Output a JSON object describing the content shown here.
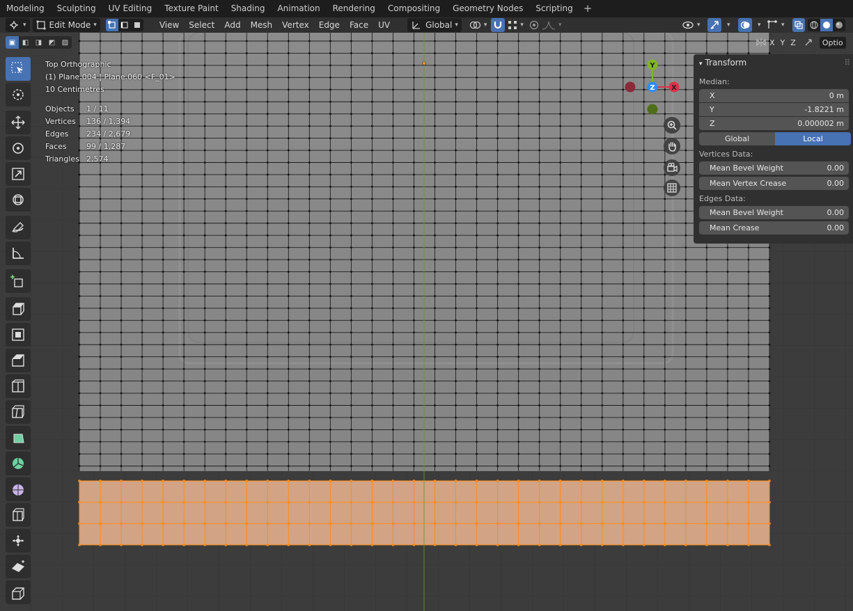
{
  "tabs": [
    "Modeling",
    "Sculpting",
    "UV Editing",
    "Texture Paint",
    "Shading",
    "Animation",
    "Rendering",
    "Compositing",
    "Geometry Nodes",
    "Scripting"
  ],
  "tab_add": "+",
  "header": {
    "mode": "Edit Mode",
    "menus": [
      "View",
      "Select",
      "Add",
      "Mesh",
      "Vertex",
      "Edge",
      "Face",
      "UV"
    ],
    "orientation": "Global",
    "options_label": "Optio"
  },
  "axis_toggles": [
    "X",
    "Y",
    "Z"
  ],
  "overlay": {
    "view_name": "Top Orthographic",
    "object_line": "(1) Plane.004 | Plane.060 <F_01>",
    "scale": "10 Centimetres",
    "stats": [
      {
        "label": "Objects",
        "value": "1 / 11"
      },
      {
        "label": "Vertices",
        "value": "136 / 1,394"
      },
      {
        "label": "Edges",
        "value": "234 / 2,679"
      },
      {
        "label": "Faces",
        "value": "99 / 1,287"
      },
      {
        "label": "Triangles",
        "value": "2,574"
      }
    ]
  },
  "gizmo": {
    "x": "X",
    "y": "Y",
    "z": "Z"
  },
  "npanel": {
    "title": "Transform",
    "median_label": "Median:",
    "x": {
      "label": "X",
      "value": "0 m"
    },
    "y": {
      "label": "Y",
      "value": "-1.8221 m"
    },
    "z": {
      "label": "Z",
      "value": "0.000002 m"
    },
    "global_label": "Global",
    "local_label": "Local",
    "vertices_data_label": "Vertices Data:",
    "mean_bevel_weight_v": {
      "label": "Mean Bevel Weight",
      "value": "0.00"
    },
    "mean_vertex_crease": {
      "label": "Mean Vertex Crease",
      "value": "0.00"
    },
    "edges_data_label": "Edges Data:",
    "mean_bevel_weight_e": {
      "label": "Mean Bevel Weight",
      "value": "0.00"
    },
    "mean_crease": {
      "label": "Mean Crease",
      "value": "0.00"
    }
  },
  "colors": {
    "accent": "#4772b3",
    "selection": "#ff8c1a",
    "axis_x": "#e0304a",
    "axis_y": "#7fb81f",
    "axis_z": "#2d8df5"
  }
}
